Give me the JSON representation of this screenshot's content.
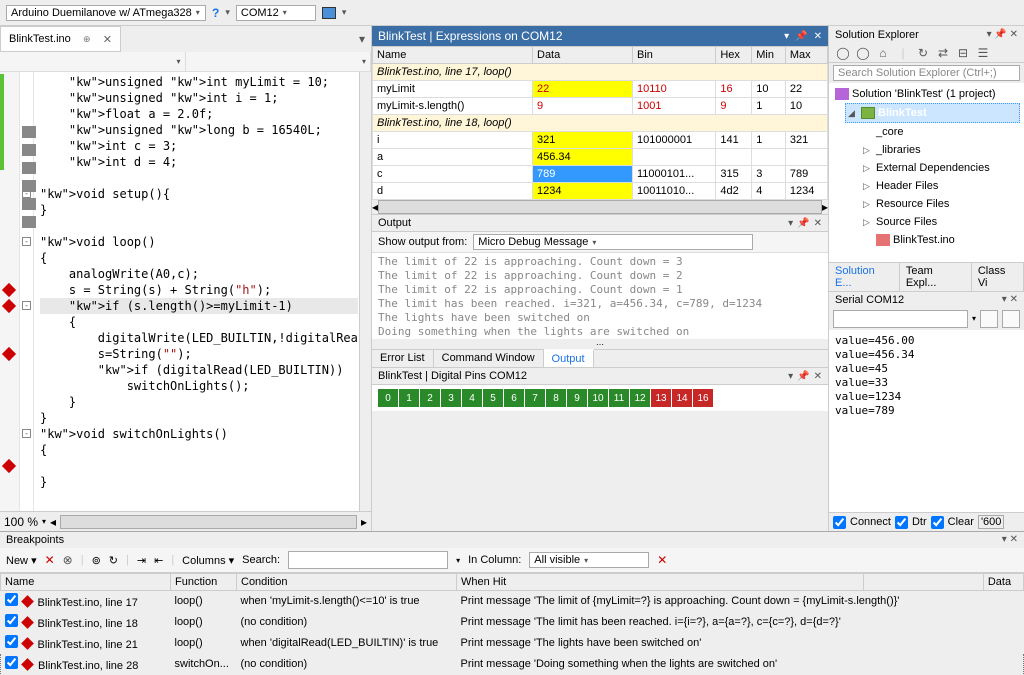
{
  "toolbar": {
    "board": "Arduino Duemilanove w/ ATmega328",
    "port": "COM12"
  },
  "editor": {
    "tab": "BlinkTest.ino",
    "zoom": "100 %",
    "lines": [
      {
        "t": "    unsigned int myLimit = 10;",
        "green": true
      },
      {
        "t": "    unsigned int i = 1;",
        "green": true
      },
      {
        "t": "    float a = 2.0f;",
        "green": true
      },
      {
        "t": "    unsigned long b = 16540L;",
        "green": true
      },
      {
        "t": "    int c = 3;",
        "green": true
      },
      {
        "t": "    int d = 4;",
        "green": true
      },
      {
        "t": ""
      },
      {
        "t": "void setup(){",
        "fold": "-",
        "box": true
      },
      {
        "t": "}",
        "box": true
      },
      {
        "t": ""
      },
      {
        "t": "void loop()",
        "fold": "-",
        "box": true
      },
      {
        "t": "{"
      },
      {
        "t": "    analogWrite(A0,c);"
      },
      {
        "t": "    s = String(s) + String(\"h\");",
        "bp": "diamond"
      },
      {
        "t": "    if (s.length()>=myLimit-1)",
        "bp": "diamond",
        "hl": true,
        "fold": "-"
      },
      {
        "t": "    {"
      },
      {
        "t": "        digitalWrite(LED_BUILTIN,!digitalRea"
      },
      {
        "t": "        s=String(\"\");",
        "bp": "diamond"
      },
      {
        "t": "        if (digitalRead(LED_BUILTIN))"
      },
      {
        "t": "            switchOnLights();"
      },
      {
        "t": "    }"
      },
      {
        "t": "}",
        "box": true
      },
      {
        "t": "void switchOnLights()",
        "fold": "-",
        "box": true
      },
      {
        "t": "{"
      },
      {
        "t": "",
        "bp": "diamond"
      },
      {
        "t": "}",
        "box": true
      }
    ]
  },
  "expressions": {
    "title": "BlinkTest | Expressions on COM12",
    "cols": [
      "Name",
      "Data",
      "Bin",
      "Hex",
      "Min",
      "Max"
    ],
    "groups": [
      {
        "label": "BlinkTest.ino, line 17, loop()",
        "rows": [
          {
            "name": "myLimit",
            "data": "22",
            "bin": "10110",
            "hex": "16",
            "min": "10",
            "max": "22",
            "yellow": true,
            "red": true
          },
          {
            "name": "myLimit-s.length()",
            "data": "9",
            "bin": "1001",
            "hex": "9",
            "min": "1",
            "max": "10",
            "red": true
          }
        ]
      },
      {
        "label": "BlinkTest.ino, line 18, loop()",
        "rows": [
          {
            "name": "i",
            "data": "321",
            "bin": "101000001",
            "hex": "141",
            "min": "1",
            "max": "321",
            "yellow": true
          },
          {
            "name": "a",
            "data": "456.34",
            "bin": "",
            "hex": "",
            "min": "",
            "max": "",
            "yellow": true
          },
          {
            "name": "c",
            "data": "789",
            "bin": "11000101...",
            "hex": "315",
            "min": "3",
            "max": "789",
            "sel": true
          },
          {
            "name": "d",
            "data": "1234",
            "bin": "10011010...",
            "hex": "4d2",
            "min": "4",
            "max": "1234",
            "yellow": true
          }
        ]
      }
    ]
  },
  "output": {
    "title": "Output",
    "source_label": "Show output from:",
    "source": "Micro Debug Message",
    "lines": [
      "The limit of 22 is approaching. Count down = 3",
      "The limit of 22 is approaching. Count down = 2",
      "The limit of 22 is approaching. Count down = 1",
      "The limit has been reached. i=321, a=456.34, c=789, d=1234",
      "The lights have been switched on",
      "Doing something when the lights are switched on"
    ],
    "tabs": [
      "Error List",
      "Command Window",
      "Output"
    ]
  },
  "digital_pins": {
    "title": "BlinkTest | Digital Pins COM12",
    "pins": [
      {
        "n": "0",
        "c": "g"
      },
      {
        "n": "1",
        "c": "g"
      },
      {
        "n": "2",
        "c": "g"
      },
      {
        "n": "3",
        "c": "g"
      },
      {
        "n": "4",
        "c": "g"
      },
      {
        "n": "5",
        "c": "g"
      },
      {
        "n": "6",
        "c": "g"
      },
      {
        "n": "7",
        "c": "g"
      },
      {
        "n": "8",
        "c": "g"
      },
      {
        "n": "9",
        "c": "g"
      },
      {
        "n": "10",
        "c": "g"
      },
      {
        "n": "11",
        "c": "g"
      },
      {
        "n": "12",
        "c": "g"
      },
      {
        "n": "13",
        "c": "r"
      },
      {
        "n": "14",
        "c": "r"
      },
      {
        "n": "16",
        "c": "r"
      }
    ]
  },
  "solution_explorer": {
    "title": "Solution Explorer",
    "search_placeholder": "Search Solution Explorer (Ctrl+;)",
    "root": "Solution 'BlinkTest' (1 project)",
    "project": "BlinkTest",
    "items": [
      "_core",
      "_libraries",
      "External Dependencies",
      "Header Files",
      "Resource Files",
      "Source Files",
      "BlinkTest.ino"
    ],
    "tabs": [
      "Solution E...",
      "Team Expl...",
      "Class Vi"
    ]
  },
  "serial": {
    "title": "Serial COM12",
    "lines": [
      "value=456.00",
      "value=456.34",
      "value=45",
      "value=33",
      "value=1234",
      "value=789"
    ],
    "connect": "Connect",
    "dtr": "Dtr",
    "clear": "Clear",
    "buf": "'600"
  },
  "breakpoints": {
    "title": "Breakpoints",
    "new": "New",
    "columns_label": "Columns",
    "search_label": "Search:",
    "incol_label": "In Column:",
    "incol_val": "All visible",
    "cols": [
      "Name",
      "Function",
      "Condition",
      "When Hit",
      "",
      "Data"
    ],
    "rows": [
      {
        "shape": "diamond",
        "name": "BlinkTest.ino, line 17",
        "fn": "loop()",
        "cond": "when 'myLimit-s.length()<=10' is true",
        "hit": "Print message 'The limit of {myLimit=?} is approaching. Count down = {myLimit-s.length()}'"
      },
      {
        "shape": "diamond",
        "name": "BlinkTest.ino, line 18",
        "fn": "loop()",
        "cond": "(no condition)",
        "hit": "Print message 'The limit has been reached. i={i=?}, a={a=?}, c={c=?}, d={d=?}'"
      },
      {
        "shape": "diamond",
        "name": "BlinkTest.ino, line 21",
        "fn": "loop()",
        "cond": "when 'digitalRead(LED_BUILTIN)' is true",
        "hit": "Print message 'The lights have been switched on'"
      },
      {
        "shape": "diamond",
        "name": "BlinkTest.ino, line 28",
        "fn": "switchOn...",
        "cond": "(no condition)",
        "hit": "Print message 'Doing something when the lights are switched on'",
        "sel": true
      }
    ]
  }
}
